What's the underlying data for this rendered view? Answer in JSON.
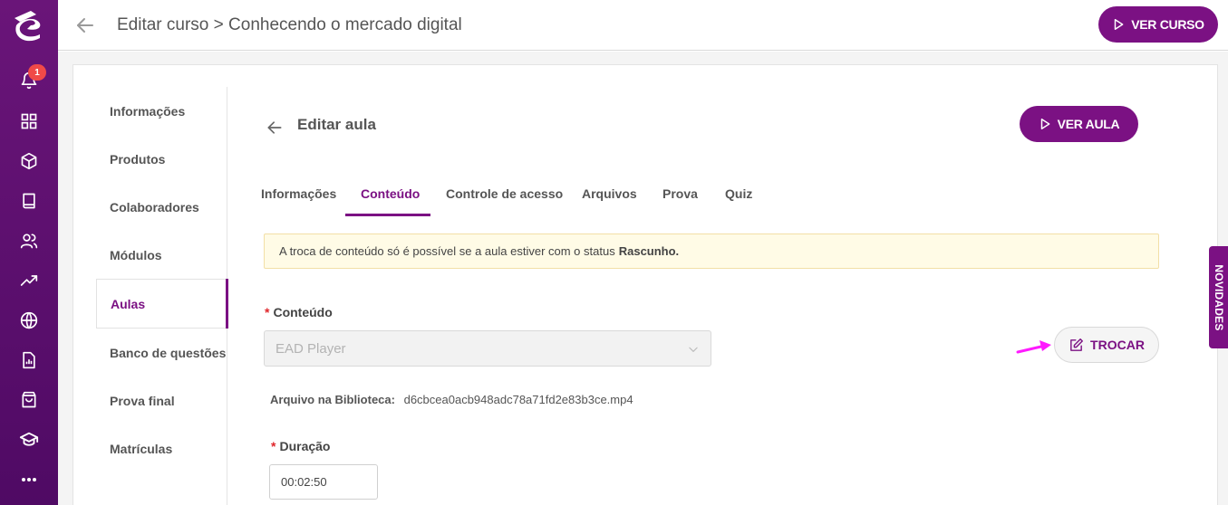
{
  "app": {
    "brand_color": "#7b1183",
    "rail_color": "#5d0f70"
  },
  "nav_rail": {
    "notification_count": "1",
    "icons": [
      "bell-icon",
      "dashboard-icon",
      "box-icon",
      "book-icon",
      "users-icon",
      "trend-icon",
      "globe-icon",
      "report-icon",
      "bag-icon",
      "graduation-cap-icon",
      "more-icon"
    ]
  },
  "header": {
    "title": "Editar curso > Conhecendo o mercado digital",
    "ver_curso_label": "VER CURSO"
  },
  "side_menu": {
    "items": [
      {
        "label": "Informações"
      },
      {
        "label": "Produtos"
      },
      {
        "label": "Colaboradores"
      },
      {
        "label": "Módulos"
      },
      {
        "label": "Aulas"
      },
      {
        "label": "Banco de questões"
      },
      {
        "label": "Prova final"
      },
      {
        "label": "Matrículas"
      }
    ],
    "active": "Aulas"
  },
  "lesson": {
    "title": "Editar aula",
    "ver_aula_label": "VER AULA",
    "tabs": [
      {
        "label": "Informações"
      },
      {
        "label": "Conteúdo"
      },
      {
        "label": "Controle de acesso"
      },
      {
        "label": "Arquivos"
      },
      {
        "label": "Prova"
      },
      {
        "label": "Quiz"
      }
    ],
    "active_tab": "Conteúdo",
    "alert_text": "A troca de conteúdo só é possível se a aula estiver com o status",
    "alert_bold": "Rascunho.",
    "content_label": "Conteúdo",
    "content_value": "EAD Player",
    "trocar_label": "TROCAR",
    "library_label": "Arquivo na Biblioteca:",
    "library_value": "d6cbcea0acb948adc78a71fd2e83b3ce.mp4",
    "duration_label": "Duração",
    "duration_value": "00:02:50",
    "required_mark": "*"
  },
  "novidades_label": "NOVIDADES"
}
